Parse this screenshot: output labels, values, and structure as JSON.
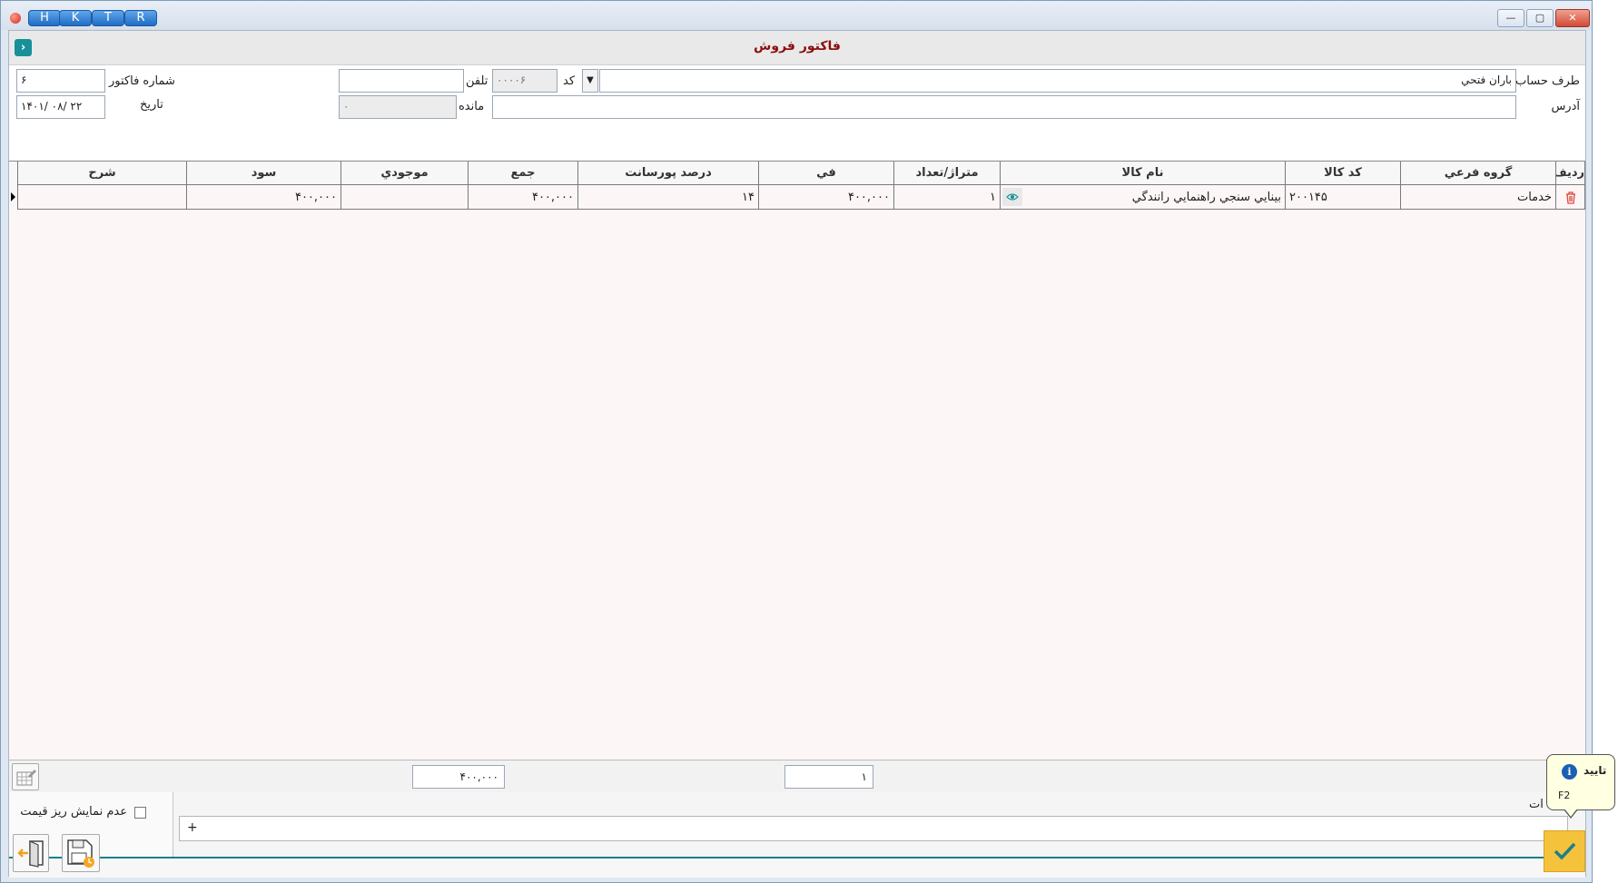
{
  "window": {
    "quick_buttons": [
      "H",
      "K",
      "T",
      "R"
    ],
    "controls": {
      "minimize": "—",
      "maximize": "▢",
      "close": "✕"
    }
  },
  "form": {
    "title": "فاكتور فروش",
    "nav_arrow": "›"
  },
  "fields": {
    "account_label": "طرف حساب",
    "account_value": "باران فتحي",
    "code_label": "كد",
    "code_value": "۰۰۰۰۶",
    "phone_label": "تلفن",
    "phone_value": "",
    "invoice_no_label": "شماره فاكتور",
    "invoice_no_value": "۶",
    "address_label": "آدرس",
    "address_value": "",
    "remaining_label": "مانده",
    "remaining_value": "۰",
    "date_label": "تاريخ",
    "date_value": "۱۴۰۱/ ۰۸/ ۲۲"
  },
  "grid": {
    "columns": [
      "رديف",
      "گروه فرعي",
      "كد كالا",
      "نام كالا",
      "متراژ/تعداد",
      "في",
      "درصد پورسانت",
      "جمع",
      "موجودي",
      "سود",
      "شرح"
    ],
    "rows": [
      {
        "group": "خدمات",
        "code": "۲۰۰۱۴۵",
        "name": "بينايي سنجي راهنمايي رانندگي",
        "qty": "۱",
        "price": "۴۰۰,۰۰۰",
        "commission": "۱۴",
        "total": "۴۰۰,۰۰۰",
        "stock": "",
        "profit": "۴۰۰,۰۰۰",
        "desc": ""
      }
    ]
  },
  "totals": {
    "qty_total": "۱",
    "sum_total": "۴۰۰,۰۰۰"
  },
  "notes": {
    "label": "ات",
    "hide_price_label": "عدم نمايش ريز قيمت",
    "add_symbol": "+"
  },
  "tooltip": {
    "title": "تاييد",
    "shortcut": "F2"
  },
  "colors": {
    "title_red": "#8b0f0f",
    "accent_teal": "#1c7f8c",
    "confirm_yellow": "#f5c23c",
    "delete_red": "#e0453a"
  }
}
